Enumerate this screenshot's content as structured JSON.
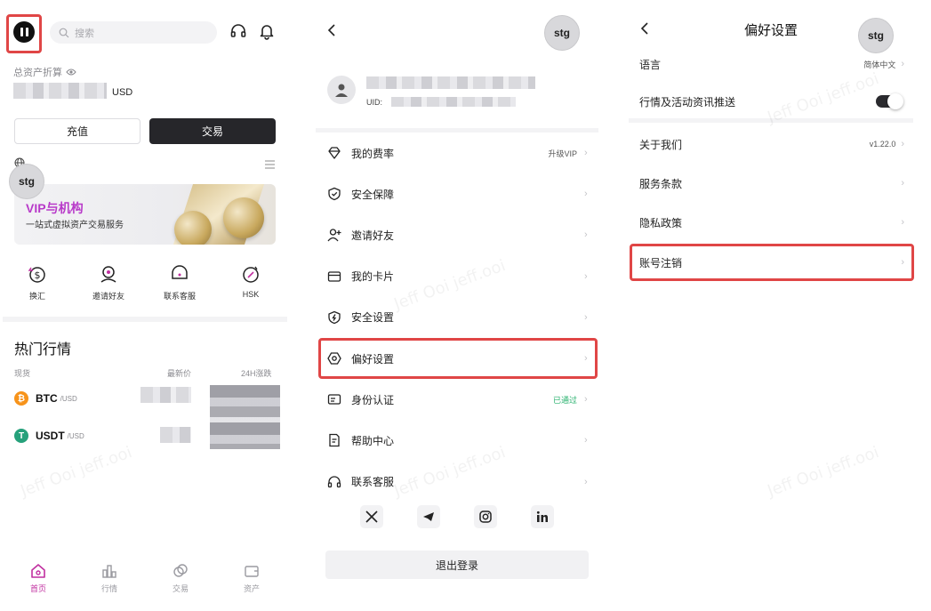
{
  "home": {
    "search_placeholder": "搜索",
    "asset_label": "总资产折算",
    "asset_currency": "USD",
    "btn_deposit": "充值",
    "btn_trade": "交易",
    "stg_badge": "stg",
    "banner_title": "VIP与机构",
    "banner_sub": "一站式虚拟资产交易服务",
    "shortcuts": [
      {
        "label": "换汇",
        "icon": "exchange-dollar-icon"
      },
      {
        "label": "邀请好友",
        "icon": "invite-friend-icon"
      },
      {
        "label": "联系客服",
        "icon": "customer-service-icon"
      },
      {
        "label": "HSK",
        "icon": "hsk-token-icon"
      }
    ],
    "hot_title": "热门行情",
    "col_spot": "现货",
    "col_price": "最新价",
    "col_change": "24H涨跌",
    "coins": [
      {
        "symbol": "BTC",
        "quote": "/USD",
        "color": "#f7931a"
      },
      {
        "symbol": "USDT",
        "quote": "/USD",
        "color": "#26a17b"
      }
    ],
    "nav": [
      {
        "label": "首页",
        "icon": "home-icon",
        "active": true
      },
      {
        "label": "行情",
        "icon": "market-icon",
        "active": false
      },
      {
        "label": "交易",
        "icon": "trade-icon",
        "active": false
      },
      {
        "label": "资产",
        "icon": "wallet-icon",
        "active": false
      }
    ]
  },
  "account": {
    "stg_badge": "stg",
    "uid_label": "UID:",
    "menu": [
      {
        "label": "我的费率",
        "icon": "diamond-icon",
        "right": "升级VIP",
        "green": false
      },
      {
        "label": "安全保障",
        "icon": "shield-check-icon",
        "right": "",
        "green": false
      },
      {
        "label": "邀请好友",
        "icon": "add-user-icon",
        "right": "",
        "green": false
      },
      {
        "label": "我的卡片",
        "icon": "card-icon",
        "right": "",
        "green": false
      },
      {
        "label": "安全设置",
        "icon": "shield-bolt-icon",
        "right": "",
        "green": false
      },
      {
        "label": "偏好设置",
        "icon": "settings-hexagon-icon",
        "right": "",
        "green": false
      },
      {
        "label": "身份认证",
        "icon": "id-card-icon",
        "right": "已通过",
        "green": true
      },
      {
        "label": "帮助中心",
        "icon": "help-doc-icon",
        "right": "",
        "green": false
      },
      {
        "label": "联系客服",
        "icon": "headset-icon",
        "right": "",
        "green": false
      }
    ],
    "logout": "退出登录"
  },
  "prefs": {
    "title": "偏好设置",
    "stg_badge": "stg",
    "language_label": "语言",
    "language_value": "简体中文",
    "push_label": "行情及活动资讯推送",
    "push_on": true,
    "about_label": "关于我们",
    "version": "v1.22.0",
    "terms_label": "服务条款",
    "privacy_label": "隐私政策",
    "delete_label": "账号注销"
  },
  "colors": {
    "accent": "#c12fa0",
    "highlight": "#e04646",
    "green": "#27b16d"
  },
  "watermark": "Jeff Ooi jeff.ooi"
}
